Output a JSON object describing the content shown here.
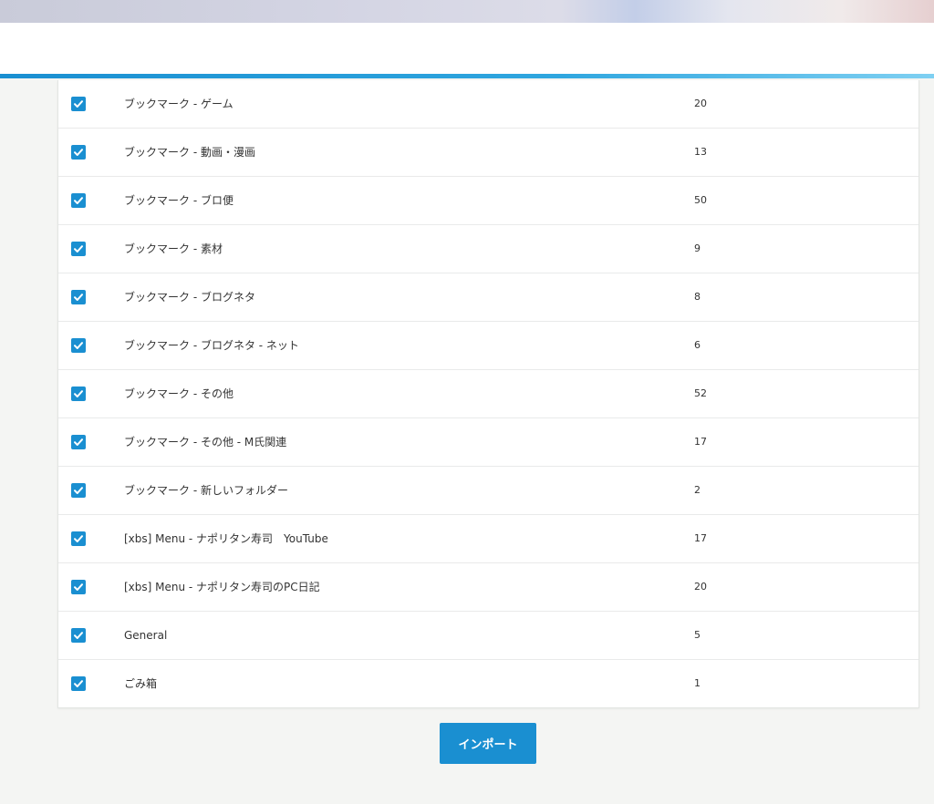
{
  "colors": {
    "accent": "#1a8fd1",
    "background": "#f4f5f3",
    "panel": "#ffffff",
    "text": "#333333"
  },
  "folders": [
    {
      "label": "ブックマーク - ゲーム",
      "count": "20",
      "checked": true
    },
    {
      "label": "ブックマーク - 動画・漫画",
      "count": "13",
      "checked": true
    },
    {
      "label": "ブックマーク - ブロ便",
      "count": "50",
      "checked": true
    },
    {
      "label": "ブックマーク - 素材",
      "count": "9",
      "checked": true
    },
    {
      "label": "ブックマーク - ブログネタ",
      "count": "8",
      "checked": true
    },
    {
      "label": "ブックマーク - ブログネタ - ネット",
      "count": "6",
      "checked": true
    },
    {
      "label": "ブックマーク - その他",
      "count": "52",
      "checked": true
    },
    {
      "label": "ブックマーク - その他 - M氏関連",
      "count": "17",
      "checked": true
    },
    {
      "label": "ブックマーク - 新しいフォルダー",
      "count": "2",
      "checked": true
    },
    {
      "label": "[xbs] Menu - ナポリタン寿司　YouTube",
      "count": "17",
      "checked": true
    },
    {
      "label": "[xbs] Menu - ナポリタン寿司のPC日記",
      "count": "20",
      "checked": true
    },
    {
      "label": "General",
      "count": "5",
      "checked": true
    },
    {
      "label": "ごみ箱",
      "count": "1",
      "checked": true
    }
  ],
  "import_button": {
    "label": "インポート"
  }
}
